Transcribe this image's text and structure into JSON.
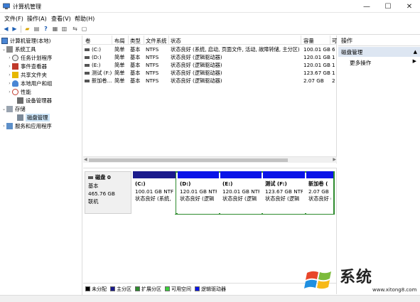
{
  "window": {
    "title": "计算机管理"
  },
  "menu": [
    "文件(F)",
    "操作(A)",
    "查看(V)",
    "帮助(H)"
  ],
  "tree": {
    "root": "计算机管理(本地)",
    "system_tools": "系统工具",
    "task_scheduler": "任务计划程序",
    "event_viewer": "事件查看器",
    "shared_folders": "共享文件夹",
    "local_users": "本地用户和组",
    "performance": "性能",
    "device_manager": "设备管理器",
    "storage": "存储",
    "disk_management": "磁盘管理",
    "services": "服务和应用程序"
  },
  "volumes": {
    "columns": [
      "卷",
      "布局",
      "类型",
      "文件系统",
      "状态",
      "容量",
      "可"
    ],
    "rows": [
      [
        "(C:)",
        "简单",
        "基本",
        "NTFS",
        "状态良好 (系统, 启动, 页面文件, 活动, 故障转储, 主分区)",
        "100.01 GB",
        "6"
      ],
      [
        "(D:)",
        "简单",
        "基本",
        "NTFS",
        "状态良好 (逻辑驱动器)",
        "120.01 GB",
        "1"
      ],
      [
        "(E:)",
        "简单",
        "基本",
        "NTFS",
        "状态良好 (逻辑驱动器)",
        "120.01 GB",
        "1"
      ],
      [
        "测试 (F:)",
        "简单",
        "基本",
        "NTFS",
        "状态良好 (逻辑驱动器)",
        "123.67 GB",
        "1"
      ],
      [
        "新加卷...",
        "简单",
        "基本",
        "NTFS",
        "状态良好 (逻辑驱动器)",
        "2.07 GB",
        "2"
      ]
    ]
  },
  "disk": {
    "name": "磁盘 0",
    "type": "基本",
    "size": "465.76 GB",
    "status": "联机",
    "partitions": [
      {
        "name": "(C:)",
        "size": "100.01 GB NTF",
        "status": "状态良好 (系统,",
        "color": "#1a1a8c"
      },
      {
        "name": "(D:)",
        "size": "120.01 GB NTF",
        "status": "状态良好 (逻辑",
        "color": "#0a14e8"
      },
      {
        "name": "(E:)",
        "size": "120.01 GB NTF",
        "status": "状态良好 (逻辑",
        "color": "#0a14e8"
      },
      {
        "name": "测试 (F:)",
        "size": "123.67 GB NTF",
        "status": "状态良好 (逻辑",
        "color": "#0a14e8"
      },
      {
        "name": "新加卷 (",
        "size": "2.07 GB",
        "status": "状态良好 (",
        "color": "#0a14e8"
      }
    ]
  },
  "legend": [
    {
      "label": "未分配",
      "color": "#000000"
    },
    {
      "label": "主分区",
      "color": "#1a1a8c"
    },
    {
      "label": "扩展分区",
      "color": "#2e8b2e"
    },
    {
      "label": "可用空间",
      "color": "#3ccf3c"
    },
    {
      "label": "逻辑驱动器",
      "color": "#0a14e8"
    }
  ],
  "actions": {
    "header": "操作",
    "section": "磁盘管理",
    "more": "更多操作"
  },
  "watermark": {
    "text": "系统",
    "text2": "统",
    "url": "www.xitong8.com"
  }
}
